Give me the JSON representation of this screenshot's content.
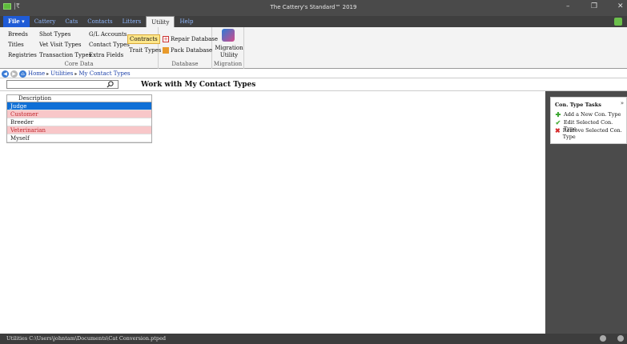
{
  "window": {
    "title": "The Cattery's Standard™ 2019",
    "minimize": "–",
    "maximize": "❐",
    "close": "✕"
  },
  "tabs": [
    {
      "label": "File ▾",
      "active": false
    },
    {
      "label": "Cattery",
      "active": false
    },
    {
      "label": "Cats",
      "active": false
    },
    {
      "label": "Contacts",
      "active": false
    },
    {
      "label": "Litters",
      "active": false
    },
    {
      "label": "Utility",
      "active": true
    },
    {
      "label": "Help",
      "active": false
    }
  ],
  "ribbon": {
    "core_data": {
      "label": "Core Data",
      "col1": [
        "Breeds",
        "Titles",
        "Registries"
      ],
      "col2": [
        "Shot Types",
        "Vet Visit Types",
        "Transaction Types"
      ],
      "col3": [
        "G/L Accounts",
        "Contact Types",
        "Extra Fields"
      ],
      "contracts": "Contracts",
      "trait_types": "Trait Types"
    },
    "database": {
      "label": "Database",
      "repair": "Repair Database",
      "pack": "Pack Database"
    },
    "migration": {
      "label": "Migration",
      "button": "Migration Utility"
    }
  },
  "breadcrumb": {
    "items": [
      "Home",
      "Utilities",
      "My Contact Types"
    ],
    "sep": "▸"
  },
  "search": {
    "value": "",
    "placeholder": ""
  },
  "page_title": "Work with My Contact Types",
  "grid": {
    "header": "Description",
    "rows": [
      {
        "label": "Judge",
        "state": "selected"
      },
      {
        "label": "Customer",
        "state": "pink"
      },
      {
        "label": "Breeder",
        "state": "normal"
      },
      {
        "label": "Veterinarian",
        "state": "pink"
      },
      {
        "label": "Myself",
        "state": "normal"
      }
    ]
  },
  "tasks": {
    "title": "Con. Type Tasks",
    "collapse": "»",
    "items": [
      {
        "label": "Add a New Con. Type",
        "icon": "add-icon"
      },
      {
        "label": "Edit Selected Con. Type",
        "icon": "check-icon"
      },
      {
        "label": "Remove Selected Con. Type",
        "icon": "remove-icon"
      }
    ]
  },
  "status": {
    "text": "Utilities   C:\\Users\\johntam\\Documents\\Cat Conversion.ptped"
  },
  "colors": {
    "selected": "#0f6fd6",
    "pink_row": "#f8c7c9",
    "file_tab": "#1f5bd6",
    "dark_panel": "#4b4b4b"
  }
}
